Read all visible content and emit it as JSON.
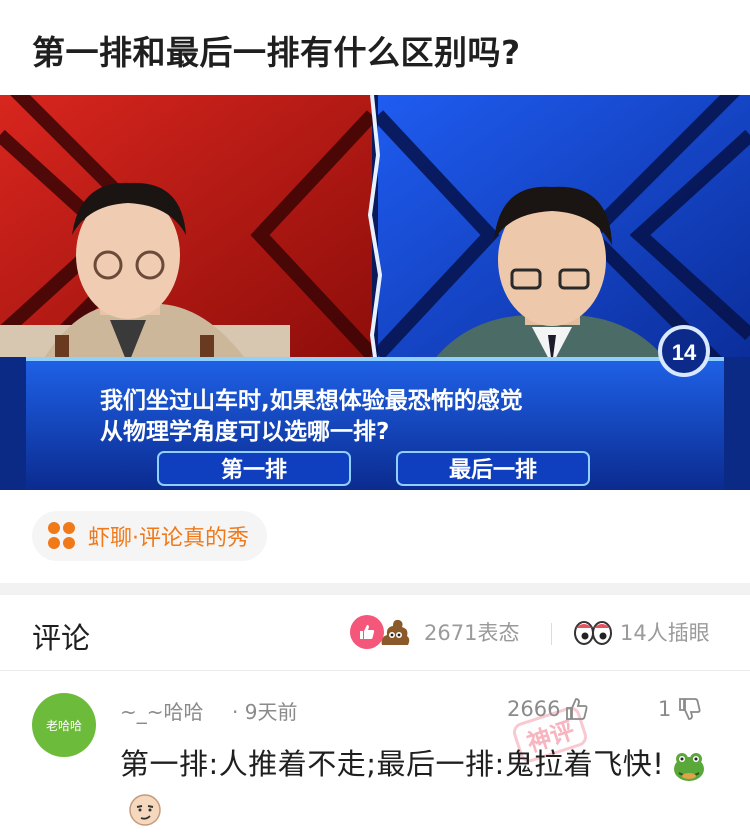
{
  "post": {
    "title": "第一排和最后一排有什么区别吗?"
  },
  "media": {
    "question_badge": "14",
    "question_line1": "我们坐过山车时,如果想体验最恐怖的感觉",
    "question_line2": "从物理学角度可以选哪一排?",
    "option_a": "第一排",
    "option_b": "最后一排"
  },
  "topic": {
    "label": "虾聊·评论真的秀",
    "icon": "four-dots-icon",
    "color": "#f07a1a"
  },
  "comments_header": {
    "title": "评论",
    "reaction_count": "2671表态",
    "eyes_count": "14人插眼",
    "like_color": "#f4577a"
  },
  "comment": {
    "avatar_text": "老哈哈",
    "username": "~_~哈哈",
    "time": "· 9天前",
    "likes": "2666",
    "dislikes": "1",
    "stamp": "神评",
    "text": "第一排:人推着不走;最后一排:鬼拉着飞快!",
    "emojis": [
      "frog-emoji",
      "smug-face-emoji"
    ]
  }
}
